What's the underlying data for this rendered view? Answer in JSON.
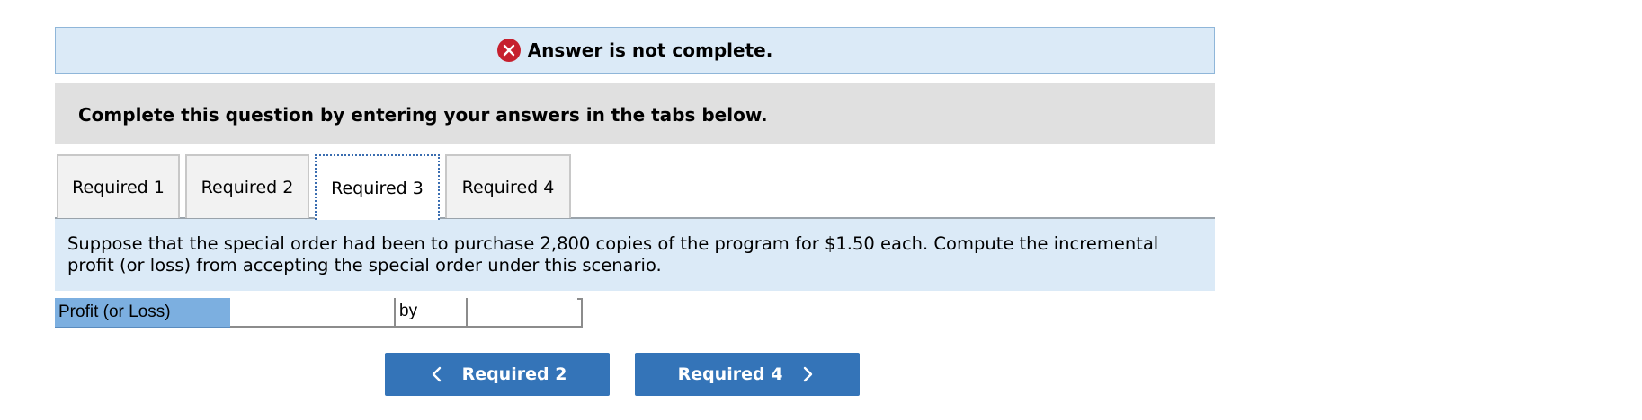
{
  "banner": {
    "text": "Answer is not complete.",
    "icon": "error-x-icon",
    "icon_color": "#c6202e"
  },
  "instructions": {
    "text": "Complete this question by entering your answers in the tabs below."
  },
  "tabs": [
    {
      "label": "Required 1",
      "active": false
    },
    {
      "label": "Required 2",
      "active": false
    },
    {
      "label": "Required 3",
      "active": true
    },
    {
      "label": "Required 4",
      "active": false
    }
  ],
  "question": {
    "line1": "Suppose that the special order had been to purchase 2,800 copies of the program for $1.50 each. Compute the incremental",
    "line2": "profit (or loss) from accepting the special order under this scenario."
  },
  "answer": {
    "label": "Profit (or Loss)",
    "value": "",
    "by_label": "by",
    "select_value": ""
  },
  "nav": {
    "prev_label": "Required 2",
    "next_label": "Required 4",
    "button_color": "#3474b8"
  }
}
